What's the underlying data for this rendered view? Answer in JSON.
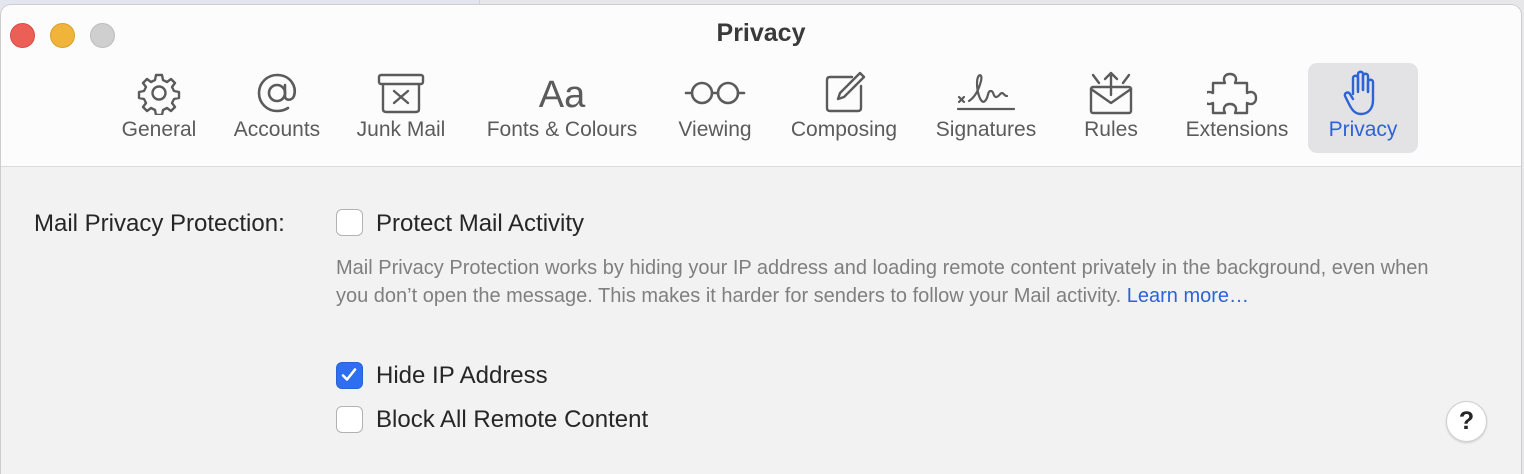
{
  "window": {
    "title": "Privacy"
  },
  "toolbar": {
    "items": [
      {
        "label": "General",
        "icon": "gear-icon",
        "active": false
      },
      {
        "label": "Accounts",
        "icon": "at-sign-icon",
        "active": false
      },
      {
        "label": "Junk Mail",
        "icon": "junk-bin-icon",
        "active": false
      },
      {
        "label": "Fonts & Colours",
        "icon": "font-aa-icon",
        "active": false
      },
      {
        "label": "Viewing",
        "icon": "glasses-icon",
        "active": false
      },
      {
        "label": "Composing",
        "icon": "compose-pencil-icon",
        "active": false
      },
      {
        "label": "Signatures",
        "icon": "signature-icon",
        "active": false
      },
      {
        "label": "Rules",
        "icon": "envelope-rules-icon",
        "active": false
      },
      {
        "label": "Extensions",
        "icon": "puzzle-piece-icon",
        "active": false
      },
      {
        "label": "Privacy",
        "icon": "hand-icon",
        "active": true
      }
    ],
    "accent_color": "#2c63d6"
  },
  "privacy": {
    "section_label": "Mail Privacy Protection:",
    "protect_mail_activity": {
      "label": "Protect Mail Activity",
      "checked": false
    },
    "description": "Mail Privacy Protection works by hiding your IP address and loading remote content privately in the background, even when you don’t open the message. This makes it harder for senders to follow your Mail activity.",
    "learn_more": "Learn more…",
    "hide_ip_address": {
      "label": "Hide IP Address",
      "checked": true
    },
    "block_remote_content": {
      "label": "Block All Remote Content",
      "checked": false
    }
  },
  "help": {
    "label": "?"
  }
}
